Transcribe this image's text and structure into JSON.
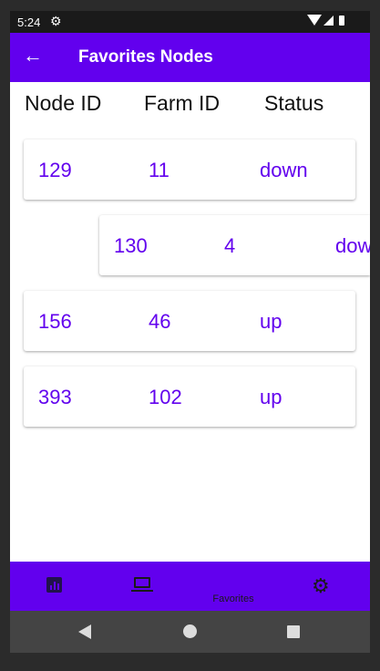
{
  "status_bar": {
    "time": "5:24",
    "settings_icon": "gear-icon",
    "wifi_icon": "wifi-icon",
    "signal_icon": "signal-icon",
    "battery_icon": "battery-icon"
  },
  "app_bar": {
    "back_icon": "arrow-back-icon",
    "title": "Favorites Nodes",
    "color": "#6200ee"
  },
  "table": {
    "headers": [
      "Node ID",
      "Farm ID",
      "Status"
    ],
    "rows": [
      {
        "node_id": "129",
        "farm_id": "11",
        "status": "down"
      },
      {
        "node_id": "130",
        "farm_id": "4",
        "status": "down"
      },
      {
        "node_id": "156",
        "farm_id": "46",
        "status": "up"
      },
      {
        "node_id": "393",
        "farm_id": "102",
        "status": "up"
      }
    ],
    "swiped_row_index": 1
  },
  "bottom_nav": {
    "items": [
      {
        "icon": "chart-icon",
        "label": ""
      },
      {
        "icon": "laptop-icon",
        "label": ""
      },
      {
        "icon": "",
        "label": "Favorites"
      },
      {
        "icon": "gear-icon",
        "label": ""
      }
    ]
  },
  "system_nav": {
    "back_icon": "back-triangle-icon",
    "home_icon": "home-circle-icon",
    "recents_icon": "recents-square-icon"
  },
  "colors": {
    "primary": "#6200ee",
    "surface": "#ffffff",
    "text": "#111111"
  }
}
